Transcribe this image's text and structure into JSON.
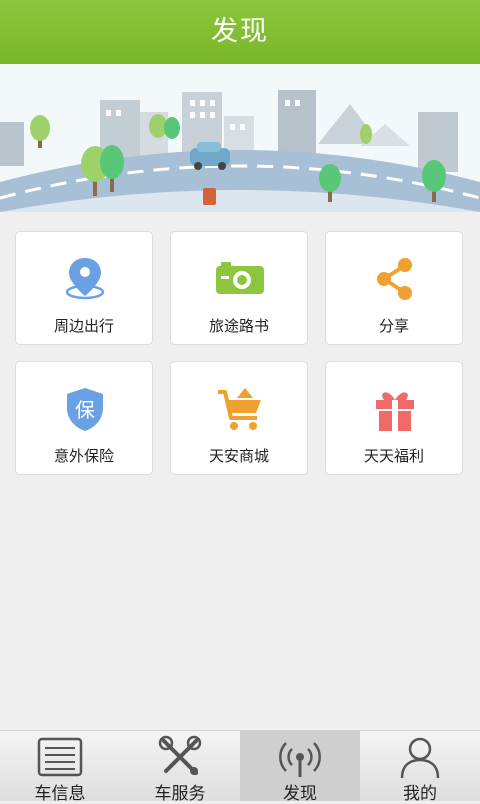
{
  "header": {
    "title": "发现"
  },
  "grid": {
    "items": [
      {
        "label": "周边出行",
        "icon": "location-pin-icon",
        "color": "#6aa0e4"
      },
      {
        "label": "旅途路书",
        "icon": "camera-icon",
        "color": "#8cc63f"
      },
      {
        "label": "分享",
        "icon": "share-icon",
        "color": "#f0a030"
      },
      {
        "label": "意外保险",
        "icon": "shield-icon",
        "color": "#6aa0e4",
        "badge": "保"
      },
      {
        "label": "天安商城",
        "icon": "shopping-cart-icon",
        "color": "#f0a030"
      },
      {
        "label": "天天福利",
        "icon": "gift-icon",
        "color": "#f06a6a"
      }
    ]
  },
  "tabbar": {
    "items": [
      {
        "label": "车信息",
        "icon": "list-icon"
      },
      {
        "label": "车服务",
        "icon": "tools-icon"
      },
      {
        "label": "发现",
        "icon": "radar-icon",
        "active": true
      },
      {
        "label": "我的",
        "icon": "user-icon"
      }
    ]
  }
}
